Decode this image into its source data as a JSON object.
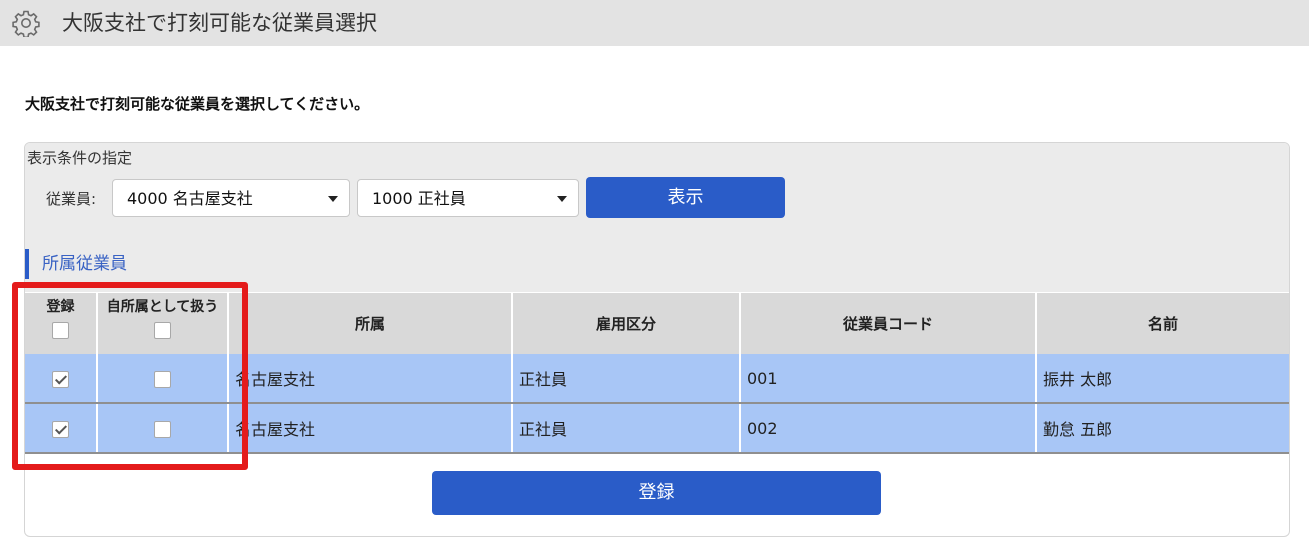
{
  "window": {
    "title": "大阪支社で打刻可能な従業員選択",
    "icon": "gear-icon"
  },
  "instruction": "大阪支社で打刻可能な従業員を選択してください。",
  "filter": {
    "section_label": "表示条件の指定",
    "employee_label": "従業員:",
    "branch_select": {
      "value": "4000 名古屋支社"
    },
    "type_select": {
      "value": "1000 正社員"
    },
    "show_button": "表示"
  },
  "members": {
    "heading": "所属従業員",
    "columns": [
      "登録",
      "自所属として扱う",
      "所属",
      "雇用区分",
      "従業員コード",
      "名前"
    ],
    "header_checkboxes": {
      "register_all": false,
      "own_all": false
    },
    "rows": [
      {
        "register": true,
        "own": false,
        "affiliation": "名古屋支社",
        "employment": "正社員",
        "code": "001",
        "name": "振井 太郎"
      },
      {
        "register": true,
        "own": false,
        "affiliation": "名古屋支社",
        "employment": "正社員",
        "code": "002",
        "name": "勤怠 五郎"
      }
    ]
  },
  "submit_button": "登録",
  "colors": {
    "accent": "#2a5cc8",
    "row_selected": "#a8c6f6",
    "header_bg": "#e3e3e3",
    "highlight": "#e41b1b"
  }
}
